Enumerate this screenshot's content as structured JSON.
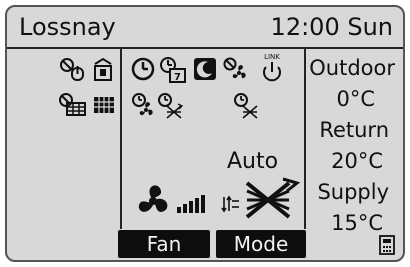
{
  "app": {
    "title": "Lossnay",
    "clock": "12:00 Sun"
  },
  "status": {
    "mode_value": "Auto"
  },
  "temps": {
    "outdoor_label": "Outdoor",
    "outdoor_value": "0°C",
    "return_label": "Return",
    "return_value": "20°C",
    "supply_label": "Supply",
    "supply_value": "15°C"
  },
  "softkeys": {
    "fan_label": "Fan",
    "mode_label": "Mode"
  },
  "icons": {
    "link_label": "LINK"
  }
}
